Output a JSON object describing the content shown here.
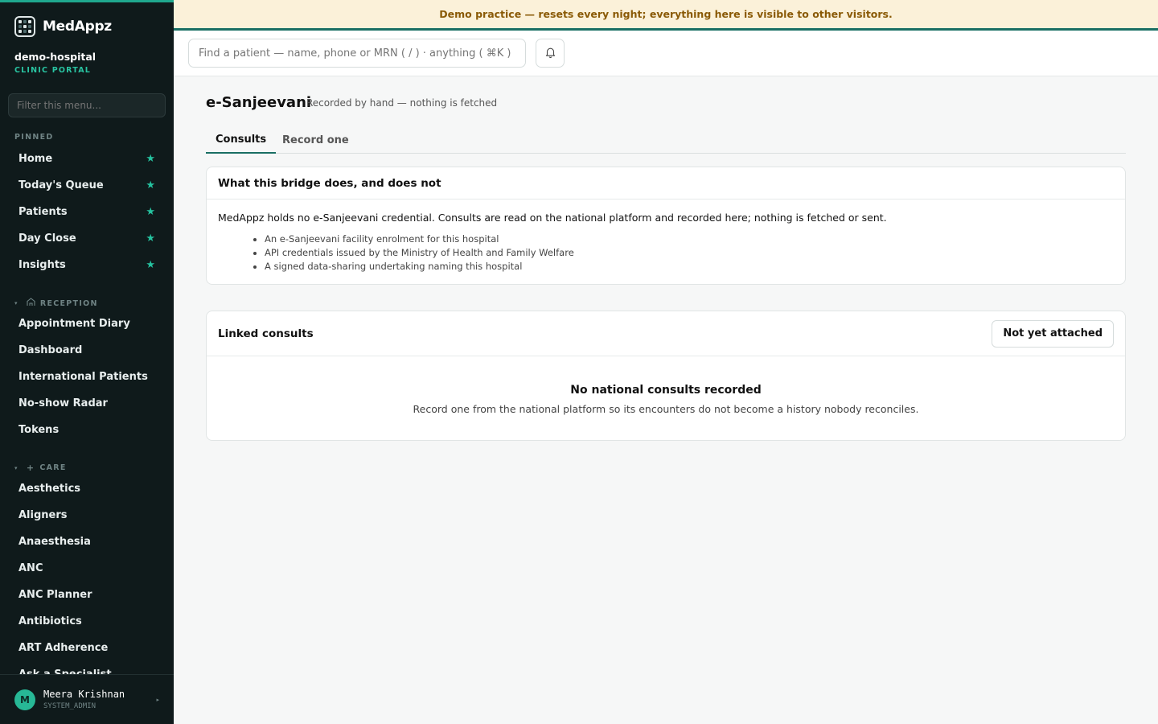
{
  "app": {
    "name": "MedAppz",
    "hospital": "demo-hospital",
    "portal": "CLINIC PORTAL"
  },
  "banner": {
    "text": "Demo practice — resets every night; everything here is visible to other visitors."
  },
  "sidebar": {
    "filter_placeholder": "Filter this menu...",
    "pinned_label": "PINNED",
    "pinned": [
      {
        "label": "Home",
        "icon": "star-icon"
      },
      {
        "label": "Today's Queue",
        "icon": "star-icon"
      },
      {
        "label": "Patients",
        "icon": "star-icon"
      },
      {
        "label": "Day Close",
        "icon": "star-icon"
      },
      {
        "label": "Insights",
        "icon": "star-icon"
      }
    ],
    "reception_label": "RECEPTION",
    "reception": [
      {
        "label": "Appointment Diary"
      },
      {
        "label": "Dashboard"
      },
      {
        "label": "International Patients"
      },
      {
        "label": "No-show Radar"
      },
      {
        "label": "Tokens"
      }
    ],
    "care_label": "CARE",
    "care": [
      {
        "label": "Aesthetics"
      },
      {
        "label": "Aligners"
      },
      {
        "label": "Anaesthesia"
      },
      {
        "label": "ANC"
      },
      {
        "label": "ANC Planner"
      },
      {
        "label": "Antibiotics"
      },
      {
        "label": "ART Adherence"
      },
      {
        "label": "Ask a Specialist"
      }
    ],
    "star_glyph": "★",
    "accent": "#25c29f"
  },
  "user": {
    "initial": "M",
    "name": "Meera Krishnan",
    "role": "SYSTEM_ADMIN"
  },
  "topbar": {
    "search_placeholder": "Find a patient — name, phone or MRN ( / ) · anything ( ⌘K )"
  },
  "page": {
    "title": "e-Sanjeevani",
    "subtitle": "Recorded by hand — nothing is fetched",
    "tabs": [
      {
        "label": "Consults"
      },
      {
        "label": "Record one"
      }
    ],
    "info_card": {
      "title": "What this bridge does, and does not",
      "lead": "MedAppz holds no e-Sanjeevani credential. Consults are read on the national platform and recorded here; nothing is fetched or sent.",
      "items": [
        "An e-Sanjeevani facility enrolment for this hospital",
        "API credentials issued by the Ministry of Health and Family Welfare",
        "A signed data-sharing undertaking naming this hospital"
      ]
    },
    "linked_card": {
      "title": "Linked consults",
      "button": "Not yet attached",
      "empty_title": "No national consults recorded",
      "empty_text": "Record one from the national platform so its encounters do not become a history nobody reconciles."
    }
  }
}
